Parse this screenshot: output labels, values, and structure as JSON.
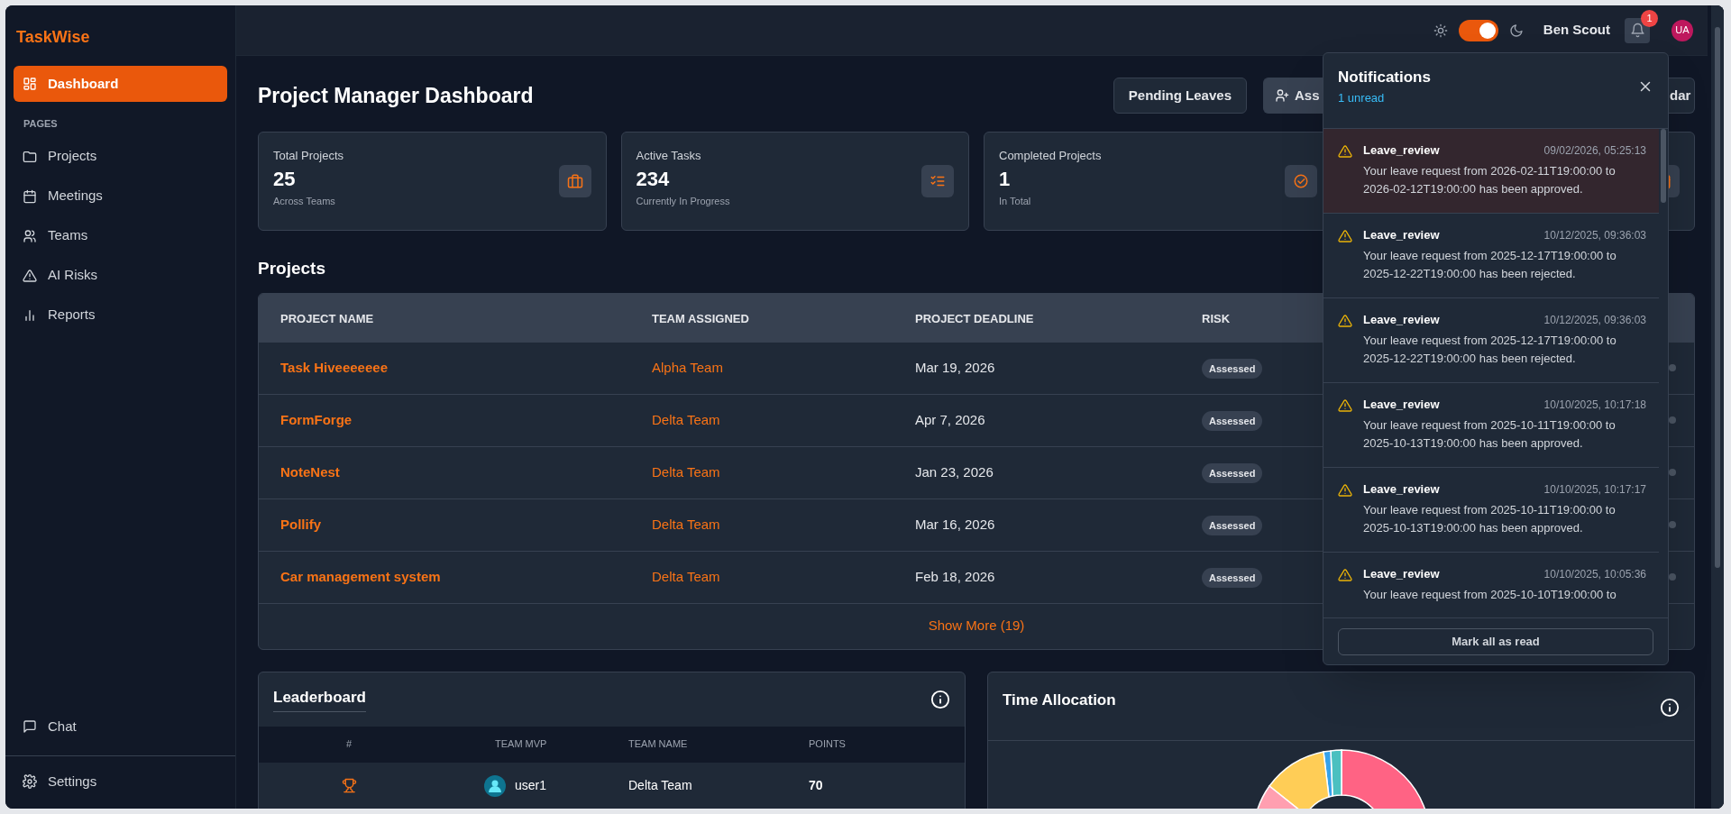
{
  "brand": "TaskWise",
  "sidebar": {
    "items": [
      {
        "label": "Dashboard",
        "selected": true
      }
    ],
    "section_label": "PAGES",
    "pages": [
      {
        "label": "Projects",
        "selected": false
      },
      {
        "label": "Meetings",
        "selected": false
      },
      {
        "label": "Teams",
        "selected": false
      },
      {
        "label": "AI Risks",
        "selected": false
      },
      {
        "label": "Reports",
        "selected": false
      }
    ],
    "bottom_items": [
      {
        "label": "Chat",
        "selected": false
      },
      {
        "label": "Settings",
        "selected": false
      }
    ]
  },
  "topbar": {
    "dark_mode": {
      "on": true
    },
    "user_name": "Ben Scout",
    "notification_count": "1",
    "avatar_initials": "UA"
  },
  "page": {
    "title": "Project Manager Dashboard",
    "buttons": [
      "Pending Leaves",
      "Ass",
      "dar"
    ]
  },
  "stats": [
    {
      "label": "Total Projects",
      "value": "25",
      "caption": "Across Teams"
    },
    {
      "label": "Active Tasks",
      "value": "234",
      "caption": "Currently In Progress"
    },
    {
      "label": "Completed Projects",
      "value": "1",
      "caption": "In Total"
    }
  ],
  "projects": {
    "title": "Projects",
    "columns": [
      "PROJECT NAME",
      "TEAM ASSIGNED",
      "PROJECT DEADLINE",
      "RISK"
    ],
    "rows": [
      {
        "name": "Task Hiveeeeeee",
        "team": "Alpha Team",
        "deadline": "Mar 19, 2026",
        "risk": "Assessed"
      },
      {
        "name": "FormForge",
        "team": "Delta Team",
        "deadline": "Apr 7, 2026",
        "risk": "Assessed"
      },
      {
        "name": "NoteNest",
        "team": "Delta Team",
        "deadline": "Jan 23, 2026",
        "risk": "Assessed"
      },
      {
        "name": "Pollify",
        "team": "Delta Team",
        "deadline": "Mar 16, 2026",
        "risk": "Assessed"
      },
      {
        "name": "Car management system",
        "team": "Delta Team",
        "deadline": "Feb 18, 2026",
        "risk": "Assessed"
      }
    ],
    "show_more": "Show More (19)"
  },
  "leaderboard": {
    "title": "Leaderboard",
    "columns": [
      "#",
      "TEAM MVP",
      "TEAM NAME",
      "POINTS"
    ],
    "rows": [
      {
        "mvp": "user1",
        "team": "Delta Team",
        "points": "70"
      }
    ]
  },
  "time_allocation": {
    "title": "Time Allocation"
  },
  "notifications": {
    "title": "Notifications",
    "unread_label": "1 unread",
    "items": [
      {
        "type": "Leave_review",
        "time": "09/02/2026, 05:25:13",
        "message": "Your leave request from 2026-02-11T19:00:00 to 2026-02-12T19:00:00 has been approved.",
        "unread": true
      },
      {
        "type": "Leave_review",
        "time": "10/12/2025, 09:36:03",
        "message": "Your leave request from 2025-12-17T19:00:00 to 2025-12-22T19:00:00 has been rejected.",
        "unread": false
      },
      {
        "type": "Leave_review",
        "time": "10/12/2025, 09:36:03",
        "message": "Your leave request from 2025-12-17T19:00:00 to 2025-12-22T19:00:00 has been rejected.",
        "unread": false
      },
      {
        "type": "Leave_review",
        "time": "10/10/2025, 10:17:18",
        "message": "Your leave request from 2025-10-11T19:00:00 to 2025-10-13T19:00:00 has been approved.",
        "unread": false
      },
      {
        "type": "Leave_review",
        "time": "10/10/2025, 10:17:17",
        "message": "Your leave request from 2025-10-11T19:00:00 to 2025-10-13T19:00:00 has been approved.",
        "unread": false
      },
      {
        "type": "Leave_review",
        "time": "10/10/2025, 10:05:36",
        "message": "Your leave request from 2025-10-10T19:00:00 to",
        "unread": false
      }
    ],
    "mark_all": "Mark all as read"
  }
}
